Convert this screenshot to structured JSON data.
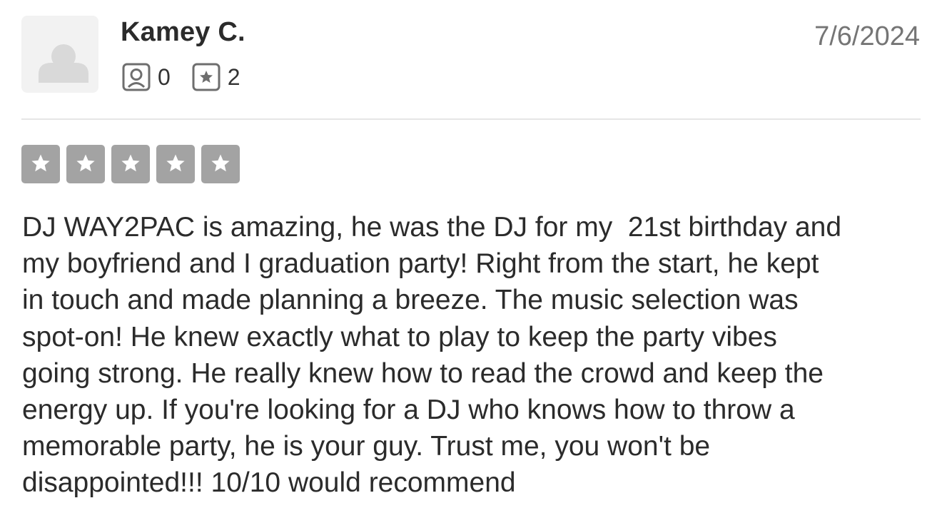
{
  "reviewer": {
    "name": "Kamey C.",
    "avatar_icon": "default-user-avatar-icon",
    "friends_icon": "user-square-icon",
    "friends_count": "0",
    "reviews_icon": "star-square-icon",
    "reviews_count": "2"
  },
  "review": {
    "date": "7/6/2024",
    "rating": 5,
    "max_rating": 5,
    "star_color": "#a3a3a3",
    "lines": [
      "DJ WAY2PAC is amazing, he was the DJ for my  21st birthday and",
      "my boyfriend and I graduation party! Right from the start, he kept",
      "in touch and made planning a breeze. The music selection was",
      "spot-on! He knew exactly what to play to keep the party vibes",
      "going strong. He really knew how to read the crowd and keep the",
      "energy up. If you're looking for a DJ who knows how to throw a",
      "memorable party, he is your guy. Trust me, you won't be",
      "disappointed!!! 10/10 would recommend"
    ]
  }
}
